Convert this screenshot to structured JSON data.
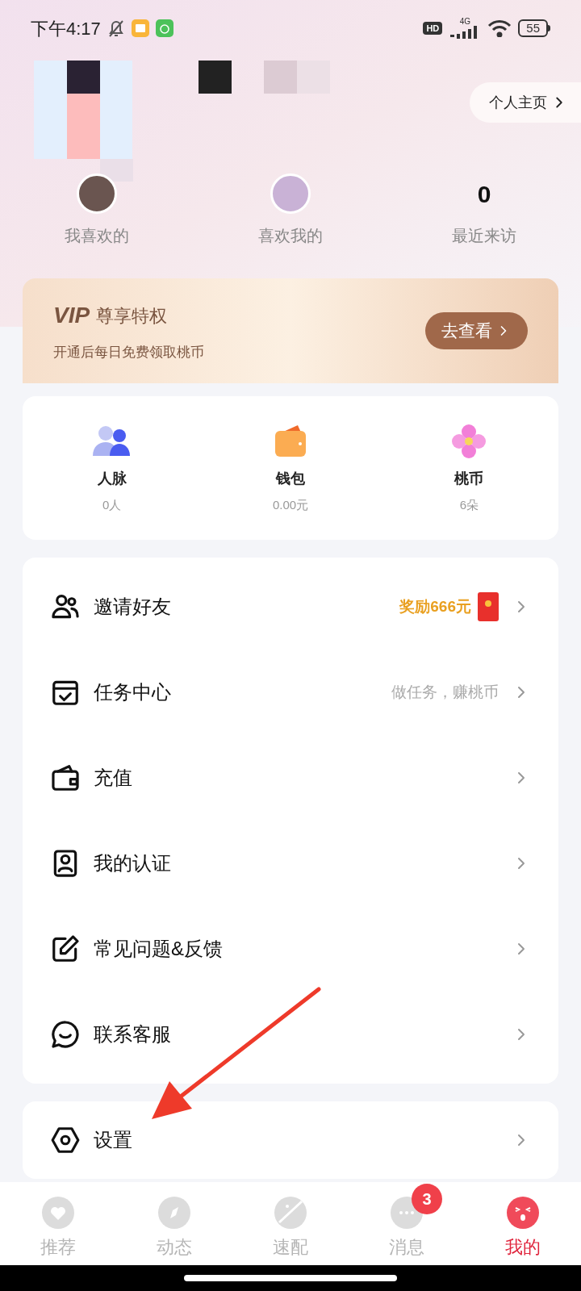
{
  "status_bar": {
    "time": "下午4:17",
    "hd": "HD",
    "network": "4G",
    "battery": "55"
  },
  "profile": {
    "homepage_button": "个人主页"
  },
  "stats": [
    {
      "kind": "avatar",
      "label": "我喜欢的"
    },
    {
      "kind": "avatar",
      "label": "喜欢我的"
    },
    {
      "kind": "count",
      "value": "0",
      "label": "最近来访"
    }
  ],
  "vip": {
    "logo": "VIP",
    "title": "尊享特权",
    "subtitle": "开通后每日免费领取桃币",
    "button": "去查看"
  },
  "assets": [
    {
      "kind": "people",
      "label": "人脉",
      "value": "0人"
    },
    {
      "kind": "wallet",
      "label": "钱包",
      "value": "0.00元"
    },
    {
      "kind": "flower",
      "label": "桃币",
      "value": "6朵"
    }
  ],
  "menu": [
    {
      "kind": "friends",
      "label": "邀请好友",
      "reward": "奖励666元"
    },
    {
      "kind": "task",
      "label": "任务中心",
      "hint": "做任务，赚桃币"
    },
    {
      "kind": "wallet",
      "label": "充值"
    },
    {
      "kind": "id",
      "label": "我的认证"
    },
    {
      "kind": "edit",
      "label": "常见问题&反馈"
    },
    {
      "kind": "chat",
      "label": "联系客服"
    }
  ],
  "settings": {
    "label": "设置"
  },
  "tabs": [
    {
      "kind": "heart",
      "label": "推荐",
      "selected": false
    },
    {
      "kind": "compass",
      "label": "动态",
      "selected": false
    },
    {
      "kind": "planet",
      "label": "速配",
      "selected": false
    },
    {
      "kind": "message",
      "label": "消息",
      "selected": false,
      "badge": "3"
    },
    {
      "kind": "face",
      "label": "我的",
      "selected": true
    }
  ]
}
